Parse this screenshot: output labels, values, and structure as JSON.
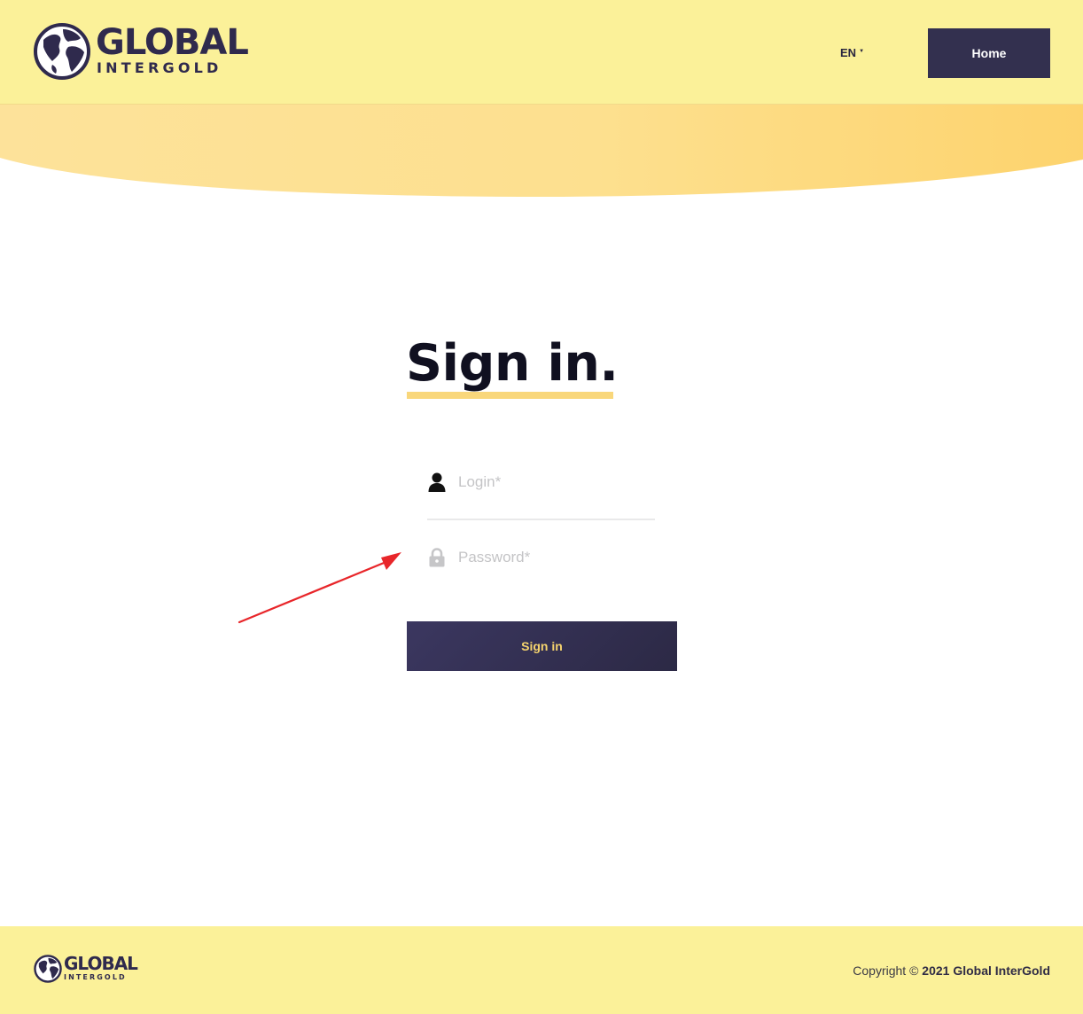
{
  "brand": {
    "name_main": "GLOBAL",
    "name_sub": "INTERGOLD"
  },
  "header": {
    "language": "EN",
    "home_label": "Home"
  },
  "main": {
    "title": "Sign in.",
    "login_placeholder": "Login*",
    "password_placeholder": "Password*",
    "submit_label": "Sign in"
  },
  "footer": {
    "copyright_prefix": "Copyright ©",
    "copyright_holder": "2021 Global InterGold"
  },
  "colors": {
    "header_bg": "#fbf199",
    "accent_gold": "#f9d77b",
    "button_navy": "#33304f",
    "arrow_red": "#e8262a"
  },
  "icons": {
    "logo": "globe-icon",
    "login": "user-icon",
    "password": "lock-icon",
    "language": "caret-down-icon"
  }
}
